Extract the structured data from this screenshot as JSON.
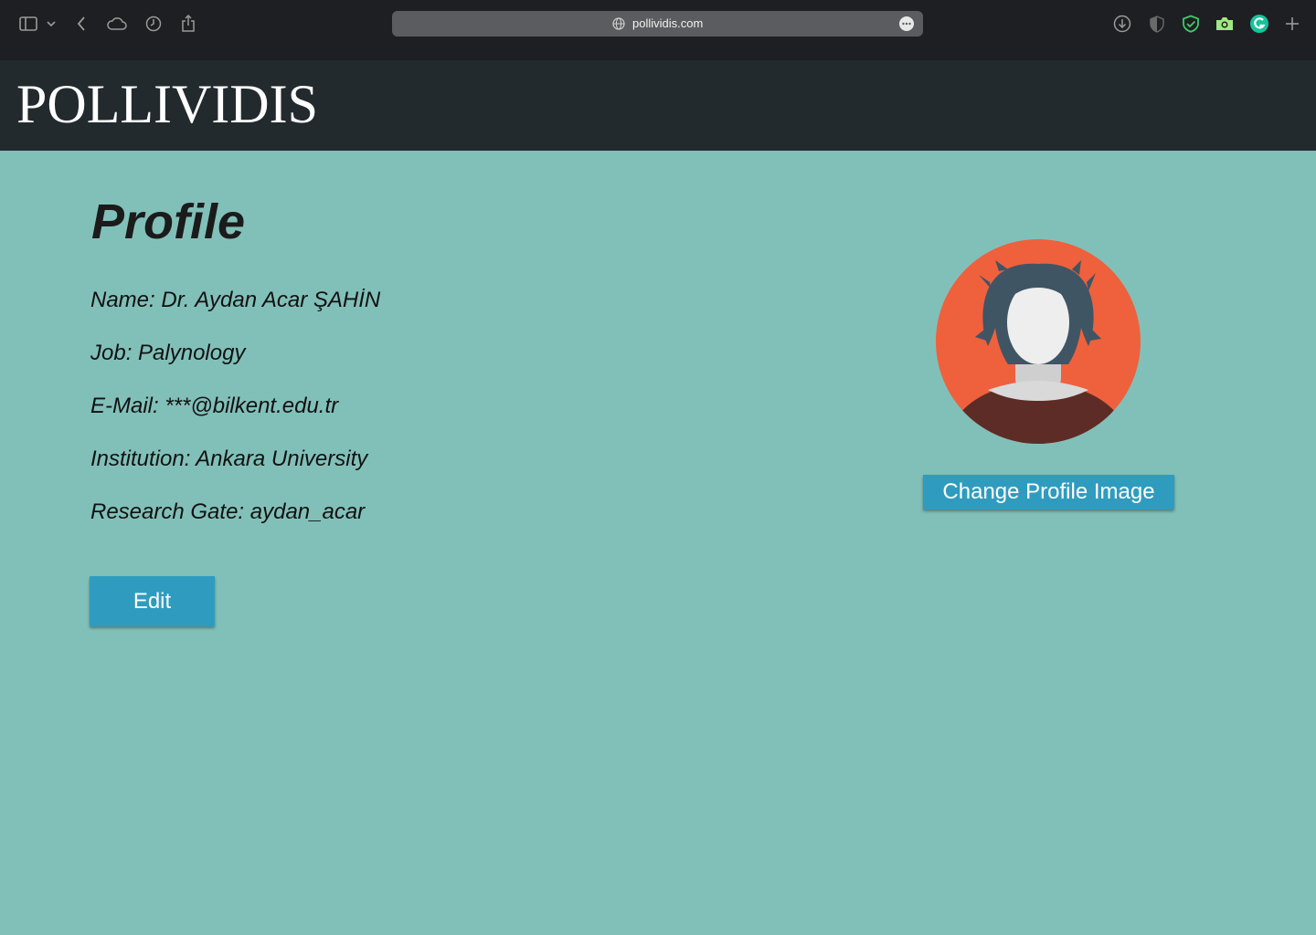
{
  "browser": {
    "url": "pollividis.com",
    "icons": [
      "sidebar-icon",
      "chevron-down-icon",
      "back-icon",
      "cloud-icon",
      "history-icon",
      "share-icon",
      "globe-icon",
      "more-icon",
      "download-icon",
      "shield-half-icon",
      "shield-check-icon",
      "camera-icon",
      "grammarly-icon",
      "plus-icon"
    ]
  },
  "site": {
    "logo": "POLLIVIDIS"
  },
  "profile": {
    "title": "Profile",
    "name": "Name: Dr. Aydan Acar ŞAHİN",
    "job": "Job: Palynology",
    "email": "E-Mail: ***@bilkent.edu.tr",
    "institution": "Institution: Ankara University",
    "research_gate": "Research Gate: aydan_acar",
    "edit_label": "Edit",
    "change_image_label": "Change Profile Image"
  },
  "colors": {
    "page_background": "#81c0b9",
    "header_background": "#232a2e",
    "button": "#2f9cbf",
    "avatar_background": "#ef603d"
  }
}
